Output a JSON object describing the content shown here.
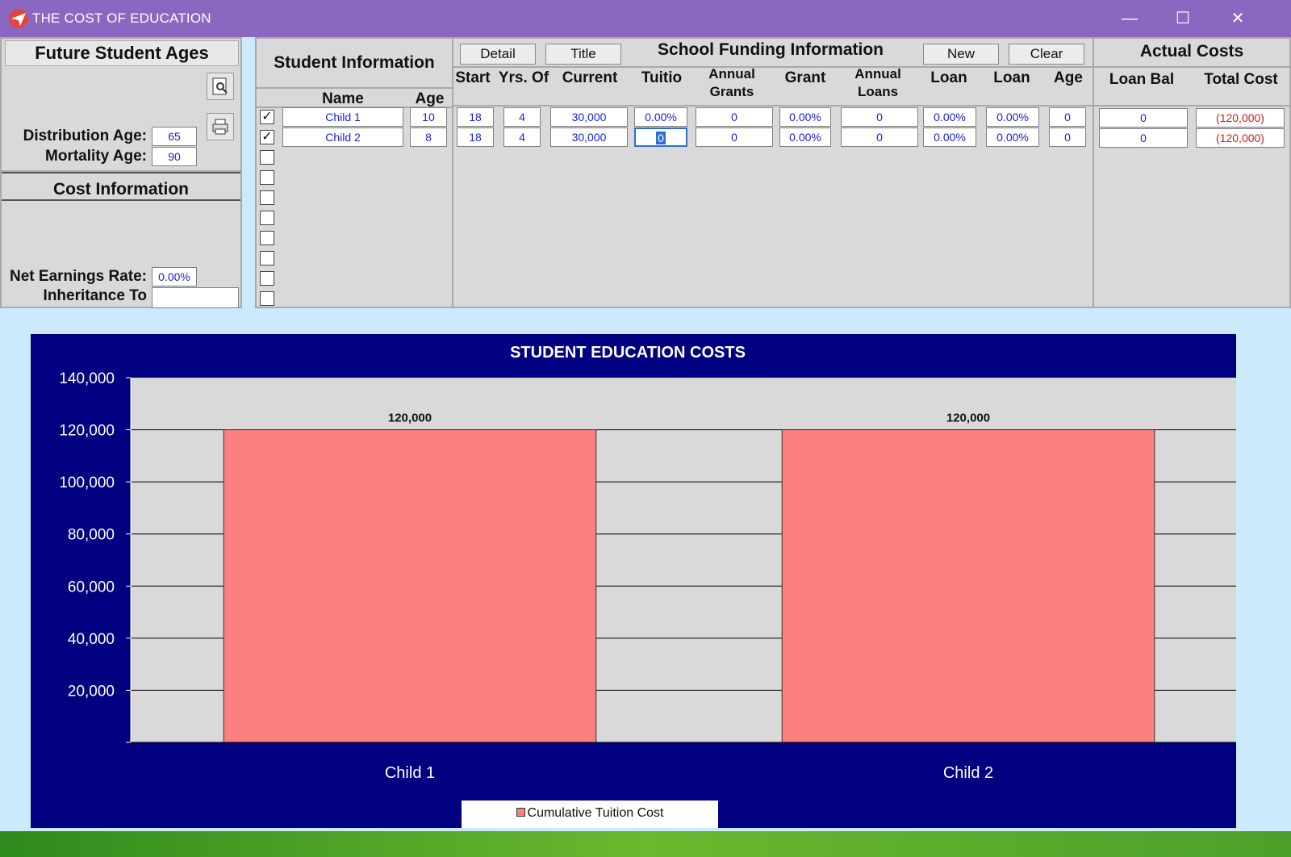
{
  "window": {
    "title": "THE COST OF EDUCATION",
    "minimize": "—",
    "maximize": "☐",
    "close": "✕"
  },
  "ages_panel": {
    "title": "Future Student Ages",
    "distribution_label": "Distribution Age:",
    "distribution_value": "65",
    "mortality_label": "Mortality Age:",
    "mortality_value": "90"
  },
  "cost_panel": {
    "title": "Cost Information",
    "net_earnings_label": "Net Earnings Rate:",
    "net_earnings_value": "0.00%",
    "inheritance_label": "Inheritance To",
    "inheritance_value": ""
  },
  "student_panel": {
    "title": "Student Information",
    "col_name": "Name",
    "col_age": "Age",
    "rows": [
      {
        "checked": true,
        "name": "Child 1",
        "age": "10"
      },
      {
        "checked": true,
        "name": "Child 2",
        "age": "8"
      },
      {
        "checked": false
      },
      {
        "checked": false
      },
      {
        "checked": false
      },
      {
        "checked": false
      },
      {
        "checked": false
      },
      {
        "checked": false
      },
      {
        "checked": false
      },
      {
        "checked": false
      }
    ]
  },
  "funding_panel": {
    "title": "School Funding Information",
    "buttons": {
      "detail": "Detail",
      "title": "Title",
      "new": "New",
      "clear": "Clear"
    },
    "columns": {
      "start": "Start",
      "yrs": "Yrs. Of",
      "current": "Current",
      "tuition": "Tuitio",
      "annual_grants_1": "Annual",
      "annual_grants_2": "Grants",
      "grant": "Grant",
      "annual_loans_1": "Annual",
      "annual_loans_2": "Loans",
      "loan1": "Loan",
      "loan2": "Loan",
      "age": "Age"
    },
    "rows": [
      {
        "start": "18",
        "yrs": "4",
        "current": "30,000",
        "tuition": "0.00%",
        "annual_grants": "0",
        "grant": "0.00%",
        "annual_loans": "0",
        "loan1": "0.00%",
        "loan2": "0.00%",
        "age": "0"
      },
      {
        "start": "18",
        "yrs": "4",
        "current": "30,000",
        "tuition": "0",
        "annual_grants": "0",
        "grant": "0.00%",
        "annual_loans": "0",
        "loan1": "0.00%",
        "loan2": "0.00%",
        "age": "0"
      }
    ]
  },
  "actual_panel": {
    "title": "Actual Costs",
    "col_loan_bal": "Loan Bal",
    "col_total_cost": "Total Cost",
    "rows": [
      {
        "loan_bal": "0",
        "total_cost": "(120,000)"
      },
      {
        "loan_bal": "0",
        "total_cost": "(120,000)"
      }
    ]
  },
  "colors": {
    "title_bar": "#8a68c2",
    "chart_bg": "#000080",
    "plot_bg": "#d9d9d9",
    "bar": "#fd8080",
    "value_text": "#1a22d6",
    "negative_text": "#d21a1a"
  },
  "chart_data": {
    "type": "bar",
    "title": "STUDENT EDUCATION COSTS",
    "categories": [
      "Child 1",
      "Child 2"
    ],
    "series": [
      {
        "name": "Cumulative Tuition Cost",
        "values": [
          120000,
          120000
        ]
      }
    ],
    "data_labels": [
      "120,000",
      "120,000"
    ],
    "yticks": [
      "",
      "20,000",
      "40,000",
      "60,000",
      "80,000",
      "100,000",
      "120,000",
      "140,000"
    ],
    "ylim": [
      0,
      140000
    ],
    "grid": true,
    "legend_position": "bottom"
  }
}
